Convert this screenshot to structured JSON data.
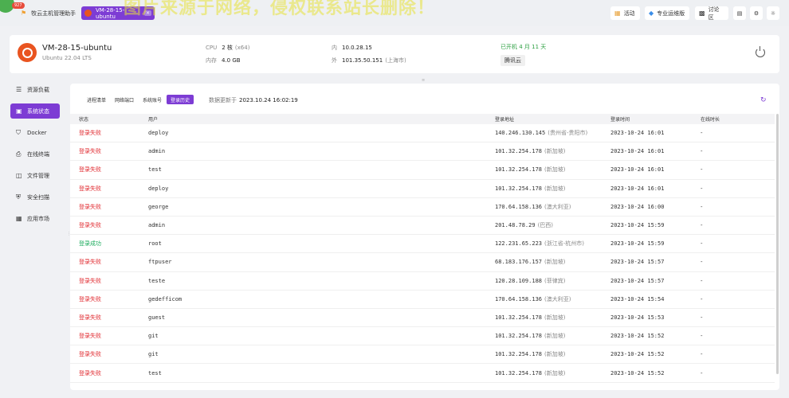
{
  "topbar": {
    "badge_count": "927",
    "home_tab": "牧云主机管理助手",
    "vm_tab": "VM-28-15-ubuntu",
    "watermark": "图片来源于网络，侵权联系站长删除！",
    "buttons": {
      "activity": "活动",
      "ops": "专业运维版",
      "forum": "讨论区"
    }
  },
  "server": {
    "name": "VM-28-15-ubuntu",
    "os": "Ubuntu 22.04 LTS",
    "cpu_label": "CPU",
    "cpu_value": "2 核",
    "cpu_arch": "(x64)",
    "mem_label": "内存",
    "mem_value": "4.0 GB",
    "inner_label": "内",
    "inner_ip": "10.0.28.15",
    "outer_label": "外",
    "outer_ip": "101.35.50.151",
    "outer_loc": "(上海市)",
    "uptime": "已开机 4 月 11 天",
    "provider": "腾讯云"
  },
  "sidebar": {
    "items": [
      {
        "label": "资源负载",
        "icon": "database-icon"
      },
      {
        "label": "系统状态",
        "icon": "monitor-icon"
      },
      {
        "label": "Docker",
        "icon": "docker-icon"
      },
      {
        "label": "在线终端",
        "icon": "terminal-icon"
      },
      {
        "label": "文件管理",
        "icon": "folder-icon"
      },
      {
        "label": "安全扫描",
        "icon": "shield-icon"
      },
      {
        "label": "应用市场",
        "icon": "apps-icon"
      }
    ]
  },
  "subtabs": [
    "进程清单",
    "网络端口",
    "系统账号",
    "登录历史"
  ],
  "update": {
    "label": "数据更新于",
    "time": "2023.10.24 16:02:19"
  },
  "table": {
    "headers": {
      "status": "状态",
      "user": "用户",
      "addr": "登录地址",
      "time": "登录时间",
      "duration": "在线时长"
    },
    "rows": [
      {
        "status": "登录失败",
        "ok": false,
        "user": "deploy",
        "ip": "140.246.130.145",
        "loc": "(贵州省-贵阳市)",
        "time": "2023-10-24 16:01",
        "dur": "-"
      },
      {
        "status": "登录失败",
        "ok": false,
        "user": "admin",
        "ip": "101.32.254.178",
        "loc": "(新加坡)",
        "time": "2023-10-24 16:01",
        "dur": "-"
      },
      {
        "status": "登录失败",
        "ok": false,
        "user": "test",
        "ip": "101.32.254.178",
        "loc": "(新加坡)",
        "time": "2023-10-24 16:01",
        "dur": "-"
      },
      {
        "status": "登录失败",
        "ok": false,
        "user": "deploy",
        "ip": "101.32.254.178",
        "loc": "(新加坡)",
        "time": "2023-10-24 16:01",
        "dur": "-"
      },
      {
        "status": "登录失败",
        "ok": false,
        "user": "george",
        "ip": "170.64.158.136",
        "loc": "(澳大利亚)",
        "time": "2023-10-24 16:00",
        "dur": "-"
      },
      {
        "status": "登录失败",
        "ok": false,
        "user": "admin",
        "ip": "201.48.78.29",
        "loc": "(巴西)",
        "time": "2023-10-24 15:59",
        "dur": "-"
      },
      {
        "status": "登录成功",
        "ok": true,
        "user": "root",
        "ip": "122.231.65.223",
        "loc": "(浙江省-杭州市)",
        "time": "2023-10-24 15:59",
        "dur": "-"
      },
      {
        "status": "登录失败",
        "ok": false,
        "user": "ftpuser",
        "ip": "68.183.176.157",
        "loc": "(新加坡)",
        "time": "2023-10-24 15:57",
        "dur": "-"
      },
      {
        "status": "登录失败",
        "ok": false,
        "user": "teste",
        "ip": "120.28.109.188",
        "loc": "(菲律宾)",
        "time": "2023-10-24 15:57",
        "dur": "-"
      },
      {
        "status": "登录失败",
        "ok": false,
        "user": "gedefficom",
        "ip": "170.64.158.136",
        "loc": "(澳大利亚)",
        "time": "2023-10-24 15:54",
        "dur": "-"
      },
      {
        "status": "登录失败",
        "ok": false,
        "user": "guest",
        "ip": "101.32.254.178",
        "loc": "(新加坡)",
        "time": "2023-10-24 15:53",
        "dur": "-"
      },
      {
        "status": "登录失败",
        "ok": false,
        "user": "git",
        "ip": "101.32.254.178",
        "loc": "(新加坡)",
        "time": "2023-10-24 15:52",
        "dur": "-"
      },
      {
        "status": "登录失败",
        "ok": false,
        "user": "git",
        "ip": "101.32.254.178",
        "loc": "(新加坡)",
        "time": "2023-10-24 15:52",
        "dur": "-"
      },
      {
        "status": "登录失败",
        "ok": false,
        "user": "test",
        "ip": "101.32.254.178",
        "loc": "(新加坡)",
        "time": "2023-10-24 15:52",
        "dur": "-"
      }
    ]
  },
  "colors": {
    "accent": "#7d3cd4",
    "fail": "#e0282e",
    "success": "#1bab5c",
    "uptime": "#2ea043"
  }
}
